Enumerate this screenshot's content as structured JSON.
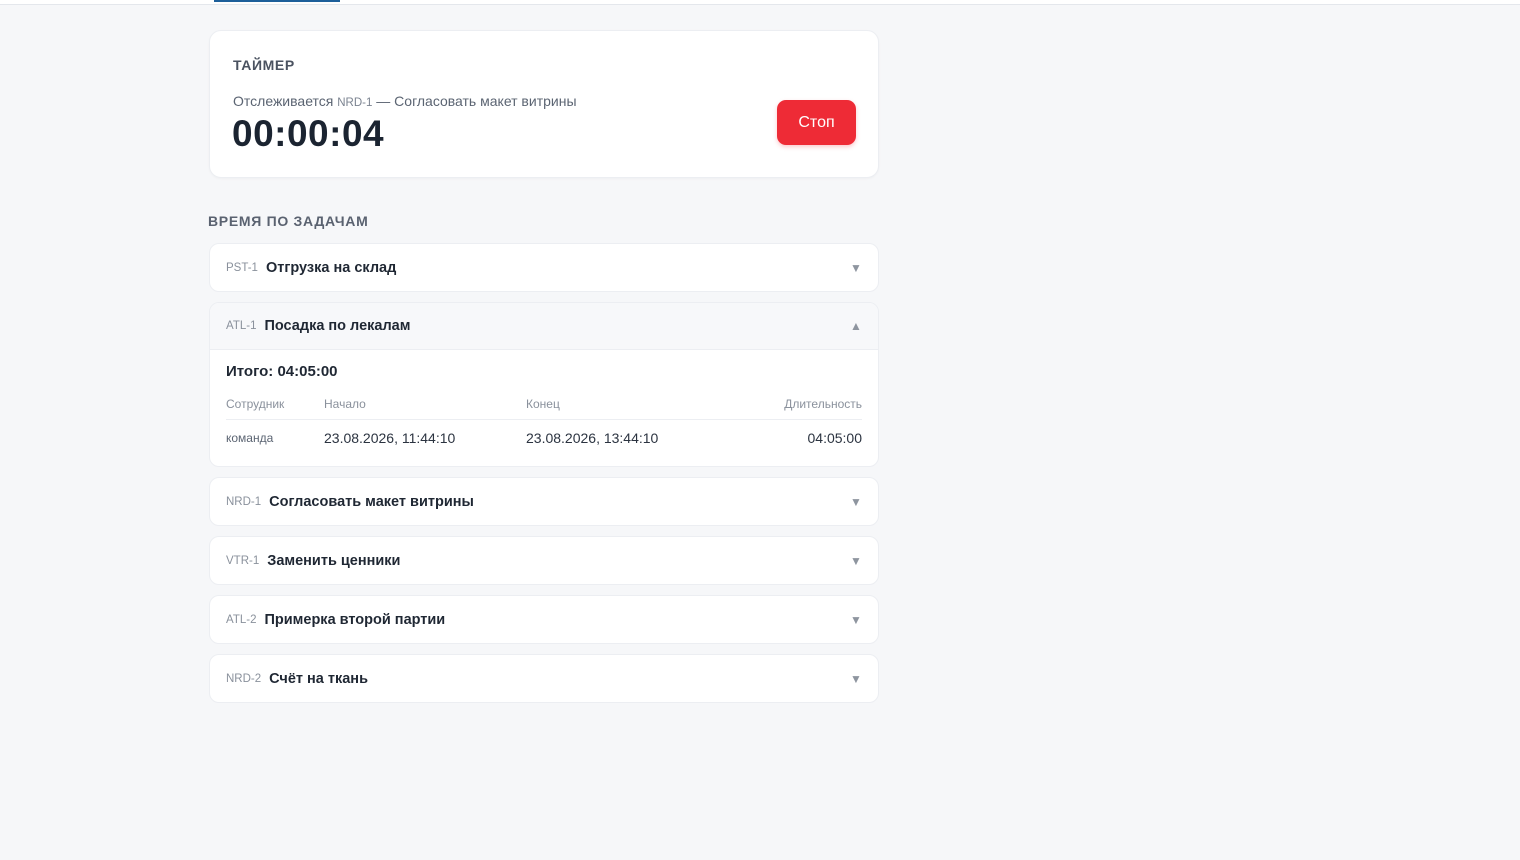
{
  "timer": {
    "title": "ТАЙМЕР",
    "tracking_prefix": "Отслеживается",
    "tracking_code": "NRD-1",
    "tracking_suffix": "— Согласовать макет витрины",
    "elapsed": "00:00:04",
    "stop_label": "Стоп"
  },
  "tasks_section": {
    "title": "ВРЕМЯ ПО ЗАДАЧАМ",
    "tasks": [
      {
        "code": "PST-1",
        "name": "Отгрузка на склад",
        "expanded": false,
        "icon": "chevron-down-icon"
      },
      {
        "code": "ATL-1",
        "name": "Посадка по лекалам",
        "expanded": true,
        "icon": "chevron-up-icon",
        "total": "Итого: 04:05:00",
        "columns": {
          "employee": "Сотрудник",
          "start": "Начало",
          "end": "Конец",
          "duration": "Длительность"
        },
        "entries": [
          {
            "employee": "команда",
            "start": "23.08.2026, 11:44:10",
            "end": "23.08.2026, 13:44:10",
            "duration": "04:05:00"
          }
        ]
      },
      {
        "code": "NRD-1",
        "name": "Согласовать макет витрины",
        "expanded": false,
        "icon": "chevron-down-icon"
      },
      {
        "code": "VTR-1",
        "name": "Заменить ценники",
        "expanded": false,
        "icon": "chevron-down-icon"
      },
      {
        "code": "ATL-2",
        "name": "Примерка второй партии",
        "expanded": false,
        "icon": "chevron-down-icon"
      },
      {
        "code": "NRD-2",
        "name": "Счёт на ткань",
        "expanded": false,
        "icon": "chevron-down-icon"
      }
    ]
  },
  "icons": {
    "chevron_down": "▼",
    "chevron_up": "▲"
  },
  "colors": {
    "accent": "#1d5f9a",
    "stop_button": "#ee2b36",
    "background": "#f6f7f9"
  }
}
